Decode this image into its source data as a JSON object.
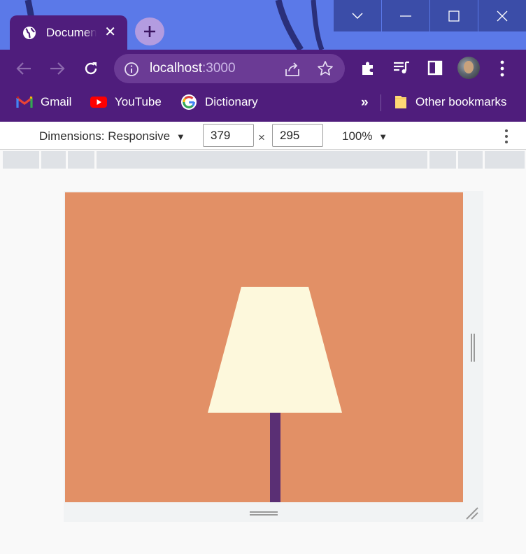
{
  "browser": {
    "tab": {
      "title": "Document",
      "icon": "globe-icon"
    },
    "window_controls": [
      "chevron-down-icon",
      "minimize-icon",
      "maximize-icon",
      "close-icon"
    ],
    "address": {
      "host": "localhost",
      "port": ":3000"
    },
    "bookmarks": [
      {
        "label": "Gmail",
        "icon": "gmail-icon"
      },
      {
        "label": "YouTube",
        "icon": "youtube-icon"
      },
      {
        "label": "Dictionary",
        "icon": "google-icon"
      }
    ],
    "more_bookmarks": "»",
    "other_bookmarks": "Other bookmarks"
  },
  "devtools": {
    "dimensions_label": "Dimensions: Responsive",
    "width": "379",
    "height": "295",
    "times": "×",
    "zoom": "100%"
  },
  "page": {
    "background_color": "#e29066",
    "shade_color": "#fdf8dc",
    "pole_color": "#5a2f74"
  }
}
